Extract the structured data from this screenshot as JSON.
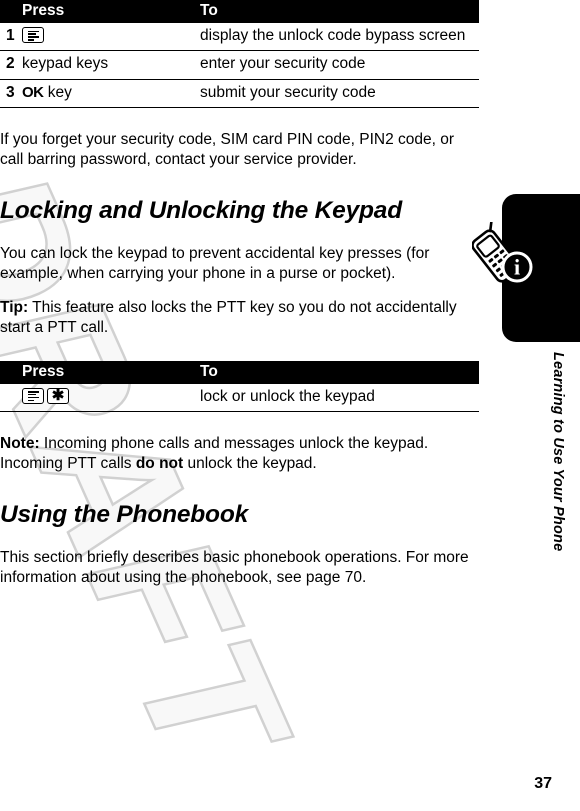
{
  "document": {
    "watermark_text": "DRAFT",
    "page_number": "37",
    "sidebar_label": "Learning to Use Your Phone",
    "sidebar_icon": "phone-info-icon",
    "accent_color": "#000000",
    "watermark_color": "#c9c9c9"
  },
  "table_unlock": {
    "headers": {
      "num": "",
      "press": "Press",
      "to": "To"
    },
    "rows": [
      {
        "num": "1",
        "press_icon": "menu-key-icon",
        "press": "",
        "to": "display the unlock code bypass screen"
      },
      {
        "num": "2",
        "press_icon": "",
        "press": "keypad keys",
        "to": "enter your security code"
      },
      {
        "num": "3",
        "press_icon": "",
        "press_bold": "OK",
        "press": " key",
        "to": "submit your security code"
      }
    ]
  },
  "paragraphs": {
    "forget_code": "If you forget your security code, SIM card PIN code, PIN2 code, or call barring password, contact your service provider.",
    "lock_intro": "You can lock the keypad to prevent accidental key presses (for example, when carrying your phone in a purse or pocket).",
    "tip_label": "Tip:",
    "tip_body": " This feature also locks the PTT key so you do not accidentally start a PTT call.",
    "note_label": "Note:",
    "note_body_1": " Incoming phone calls and messages unlock the keypad. Incoming PTT calls ",
    "note_bold": "do not",
    "note_body_2": " unlock the keypad.",
    "phonebook_intro": "This section briefly describes basic phonebook operations. For more information about using the phonebook, see page 70."
  },
  "headings": {
    "locking": "Locking and Unlocking the Keypad",
    "phonebook": "Using the Phonebook"
  },
  "table_keypad_lock": {
    "headers": {
      "press": "Press",
      "to": "To"
    },
    "rows": [
      {
        "press_icon_1": "menu-key-icon",
        "press_icon_2": "star-key-icon",
        "press": "",
        "to": "lock or unlock the keypad"
      }
    ]
  }
}
